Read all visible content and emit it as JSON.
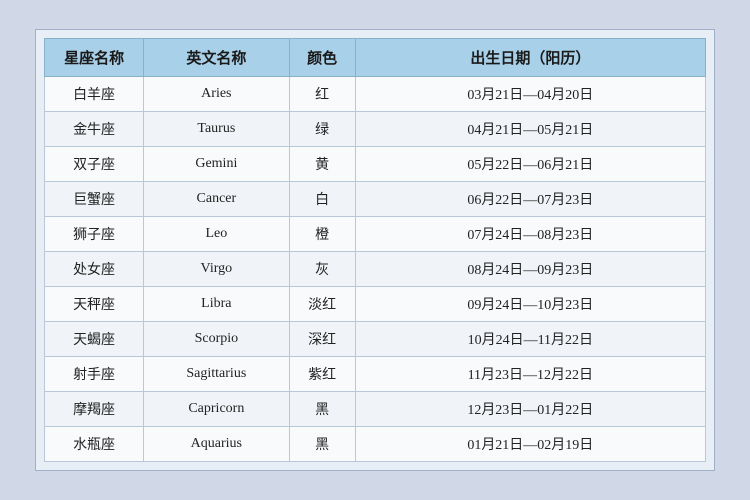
{
  "table": {
    "headers": [
      {
        "id": "header-chinese",
        "label": "星座名称"
      },
      {
        "id": "header-english",
        "label": "英文名称"
      },
      {
        "id": "header-color",
        "label": "颜色"
      },
      {
        "id": "header-date",
        "label": "出生日期（阳历）"
      }
    ],
    "rows": [
      {
        "chinese": "白羊座",
        "english": "Aries",
        "color": "红",
        "date": "03月21日—04月20日"
      },
      {
        "chinese": "金牛座",
        "english": "Taurus",
        "color": "绿",
        "date": "04月21日—05月21日"
      },
      {
        "chinese": "双子座",
        "english": "Gemini",
        "color": "黄",
        "date": "05月22日—06月21日"
      },
      {
        "chinese": "巨蟹座",
        "english": "Cancer",
        "color": "白",
        "date": "06月22日—07月23日"
      },
      {
        "chinese": "狮子座",
        "english": "Leo",
        "color": "橙",
        "date": "07月24日—08月23日"
      },
      {
        "chinese": "处女座",
        "english": "Virgo",
        "color": "灰",
        "date": "08月24日—09月23日"
      },
      {
        "chinese": "天秤座",
        "english": "Libra",
        "color": "淡红",
        "date": "09月24日—10月23日"
      },
      {
        "chinese": "天蝎座",
        "english": "Scorpio",
        "color": "深红",
        "date": "10月24日—11月22日"
      },
      {
        "chinese": "射手座",
        "english": "Sagittarius",
        "color": "紫红",
        "date": "11月23日—12月22日"
      },
      {
        "chinese": "摩羯座",
        "english": "Capricorn",
        "color": "黑",
        "date": "12月23日—01月22日"
      },
      {
        "chinese": "水瓶座",
        "english": "Aquarius",
        "color": "黑",
        "date": "01月21日—02月19日"
      }
    ]
  }
}
